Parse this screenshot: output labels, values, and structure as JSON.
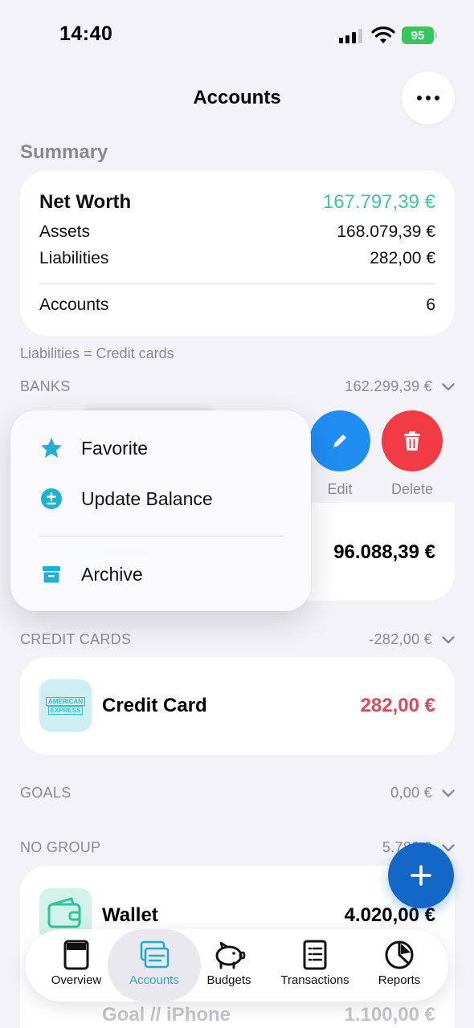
{
  "status_bar": {
    "time": "14:40",
    "battery": "95"
  },
  "header": {
    "title": "Accounts"
  },
  "summary": {
    "heading": "Summary",
    "net_worth_label": "Net Worth",
    "net_worth_value": "167.797,39 €",
    "assets_label": "Assets",
    "assets_value": "168.079,39 €",
    "liabilities_label": "Liabilities",
    "liabilities_value": "282,00 €",
    "accounts_label": "Accounts",
    "accounts_value": "6",
    "footnote": "Liabilities = Credit cards"
  },
  "groups": {
    "banks": {
      "label": "BANKS",
      "total": "162.299,39 €",
      "visible_amount": "96.088,39 €"
    },
    "credit_cards": {
      "label": "CREDIT CARDS",
      "total": "-282,00 €"
    },
    "goals": {
      "label": "GOALS",
      "total": "0,00 €"
    },
    "no_group": {
      "label": "NO GROUP",
      "total": "5.780,0"
    }
  },
  "swipe_actions": {
    "edit": "Edit",
    "delete": "Delete"
  },
  "context_menu": {
    "favorite": "Favorite",
    "update_balance": "Update Balance",
    "archive": "Archive"
  },
  "accounts": {
    "credit_card": {
      "icon_text_1": "AMERICAN",
      "icon_text_2": "EXPRESS",
      "name": "Credit Card",
      "amount": "282,00 €"
    },
    "wallet": {
      "name": "Wallet",
      "amount": "4.020,00 €"
    },
    "goal_iphone": {
      "name": "Goal // iPhone",
      "amount": "1.100,00 €"
    }
  },
  "tab_bar": {
    "overview": "Overview",
    "accounts": "Accounts",
    "budgets": "Budgets",
    "transactions": "Transactions",
    "reports": "Reports",
    "active": "Accounts"
  },
  "colors": {
    "background": "#f2f2f7",
    "net_worth": "#3dc99e",
    "negative": "#e0475d",
    "accent": "#27a9cf",
    "edit": "#1f8df2",
    "delete": "#f23b45",
    "fab": "#1267c7",
    "battery": "#34c759"
  },
  "icons": [
    "star-icon",
    "plus-circle-icon",
    "archive-box-icon",
    "pencil-icon",
    "trash-icon",
    "plus-icon",
    "chevron-down-icon",
    "wallet-icon",
    "amex-logo-icon",
    "wifi-icon",
    "signal-icon",
    "battery-icon"
  ]
}
